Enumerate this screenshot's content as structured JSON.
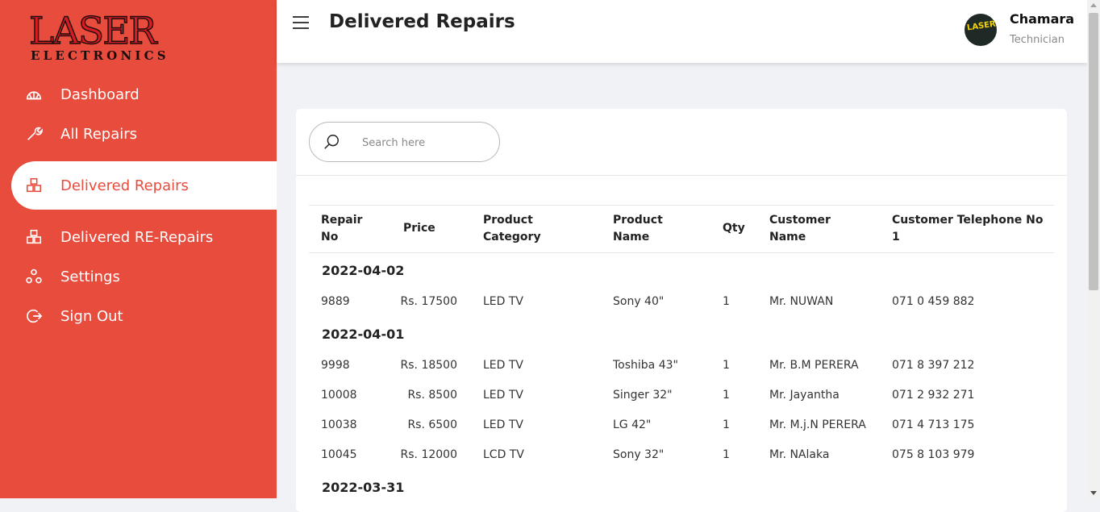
{
  "brand": {
    "logo_top": "LASER",
    "logo_bottom": "ELECTRONICS"
  },
  "sidebar": {
    "items": [
      {
        "label": "Dashboard",
        "icon": "dashboard-icon"
      },
      {
        "label": "All Repairs",
        "icon": "tools-icon"
      },
      {
        "label": "Delivered Repairs",
        "icon": "boxes-icon",
        "active": true
      },
      {
        "label": "Delivered RE-Repairs",
        "icon": "boxes-icon"
      },
      {
        "label": "Settings",
        "icon": "settings-icon"
      },
      {
        "label": "Sign Out",
        "icon": "sign-out-icon"
      }
    ]
  },
  "header": {
    "title": "Delivered Repairs",
    "user": {
      "name": "Chamara",
      "role": "Technician",
      "avatar_text": "LASER"
    }
  },
  "search": {
    "placeholder": "Search here"
  },
  "table": {
    "columns": [
      "Repair No",
      "Price",
      "Product Category",
      "Product Name",
      "Qty",
      "Customer Name",
      "Customer Telephone No 1"
    ],
    "column_display": [
      [
        "Repair",
        "No"
      ],
      [
        "Price"
      ],
      [
        "Product",
        "Category"
      ],
      [
        "Product",
        "Name"
      ],
      [
        "Qty"
      ],
      [
        "Customer",
        "Name"
      ],
      [
        "Customer Telephone No",
        "1"
      ]
    ],
    "groups": [
      {
        "date": "2022-04-02",
        "rows": [
          [
            "9889",
            "Rs. 17500",
            "LED TV",
            "Sony 40\"",
            "1",
            "Mr. NUWAN",
            "071 0 459 882"
          ]
        ]
      },
      {
        "date": "2022-04-01",
        "rows": [
          [
            "9998",
            "Rs. 18500",
            "LED TV",
            "Toshiba 43\"",
            "1",
            "Mr. B.M PERERA",
            "071 8 397 212"
          ],
          [
            "10008",
            "Rs. 8500",
            "LED TV",
            "Singer 32\"",
            "1",
            "Mr. Jayantha",
            "071 2 932 271"
          ],
          [
            "10038",
            "Rs. 6500",
            "LED TV",
            "LG 42\"",
            "1",
            "Mr. M.j.N PERERA",
            "071 4 713 175"
          ],
          [
            "10045",
            "Rs. 12000",
            "LCD TV",
            "Sony 32\"",
            "1",
            "Mr. NAlaka",
            "075 8 103 979"
          ]
        ]
      },
      {
        "date": "2022-03-31",
        "rows": []
      }
    ]
  },
  "colors": {
    "accent": "#e84c3d",
    "background": "#f1f2f6"
  }
}
